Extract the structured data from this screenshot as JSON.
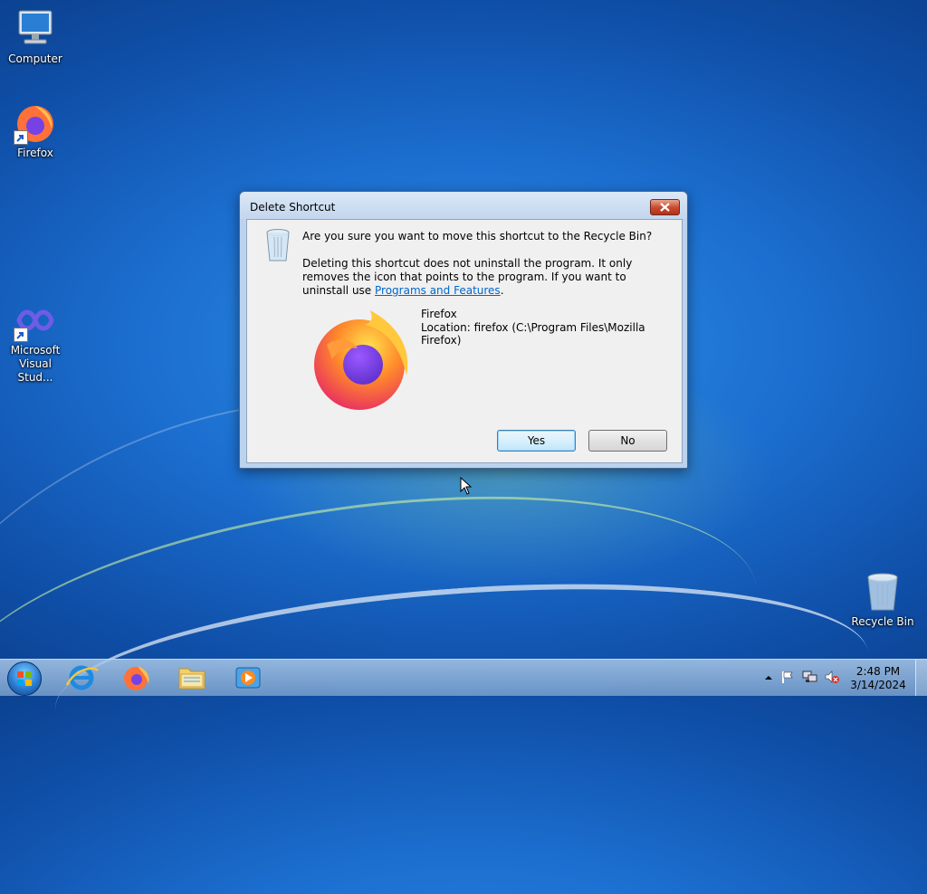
{
  "desktop": {
    "icons": [
      {
        "label": "Computer"
      },
      {
        "label": "Firefox"
      },
      {
        "label_line1": "Microsoft",
        "label_line2": "Visual Stud..."
      },
      {
        "label": "Recycle Bin"
      }
    ]
  },
  "dialog": {
    "title": "Delete Shortcut",
    "question": "Are you sure you want to move this shortcut to the Recycle Bin?",
    "detail": "Deleting this shortcut does not uninstall the program. It only removes the icon that points to the program. If you want to uninstall use ",
    "link_text": "Programs and Features",
    "detail_end": ".",
    "item_name": "Firefox",
    "item_location": "Location: firefox (C:\\Program Files\\Mozilla Firefox)",
    "yes_label": "Yes",
    "no_label": "No"
  },
  "taskbar": {
    "pinned": [
      "internet-explorer-icon",
      "firefox-icon",
      "file-explorer-icon",
      "media-player-icon"
    ],
    "time": "2:48 PM",
    "date": "3/14/2024"
  },
  "colors": {
    "desktop_blue": "#1c6fd0",
    "link": "#0066cc",
    "close_red": "#c8472d"
  }
}
